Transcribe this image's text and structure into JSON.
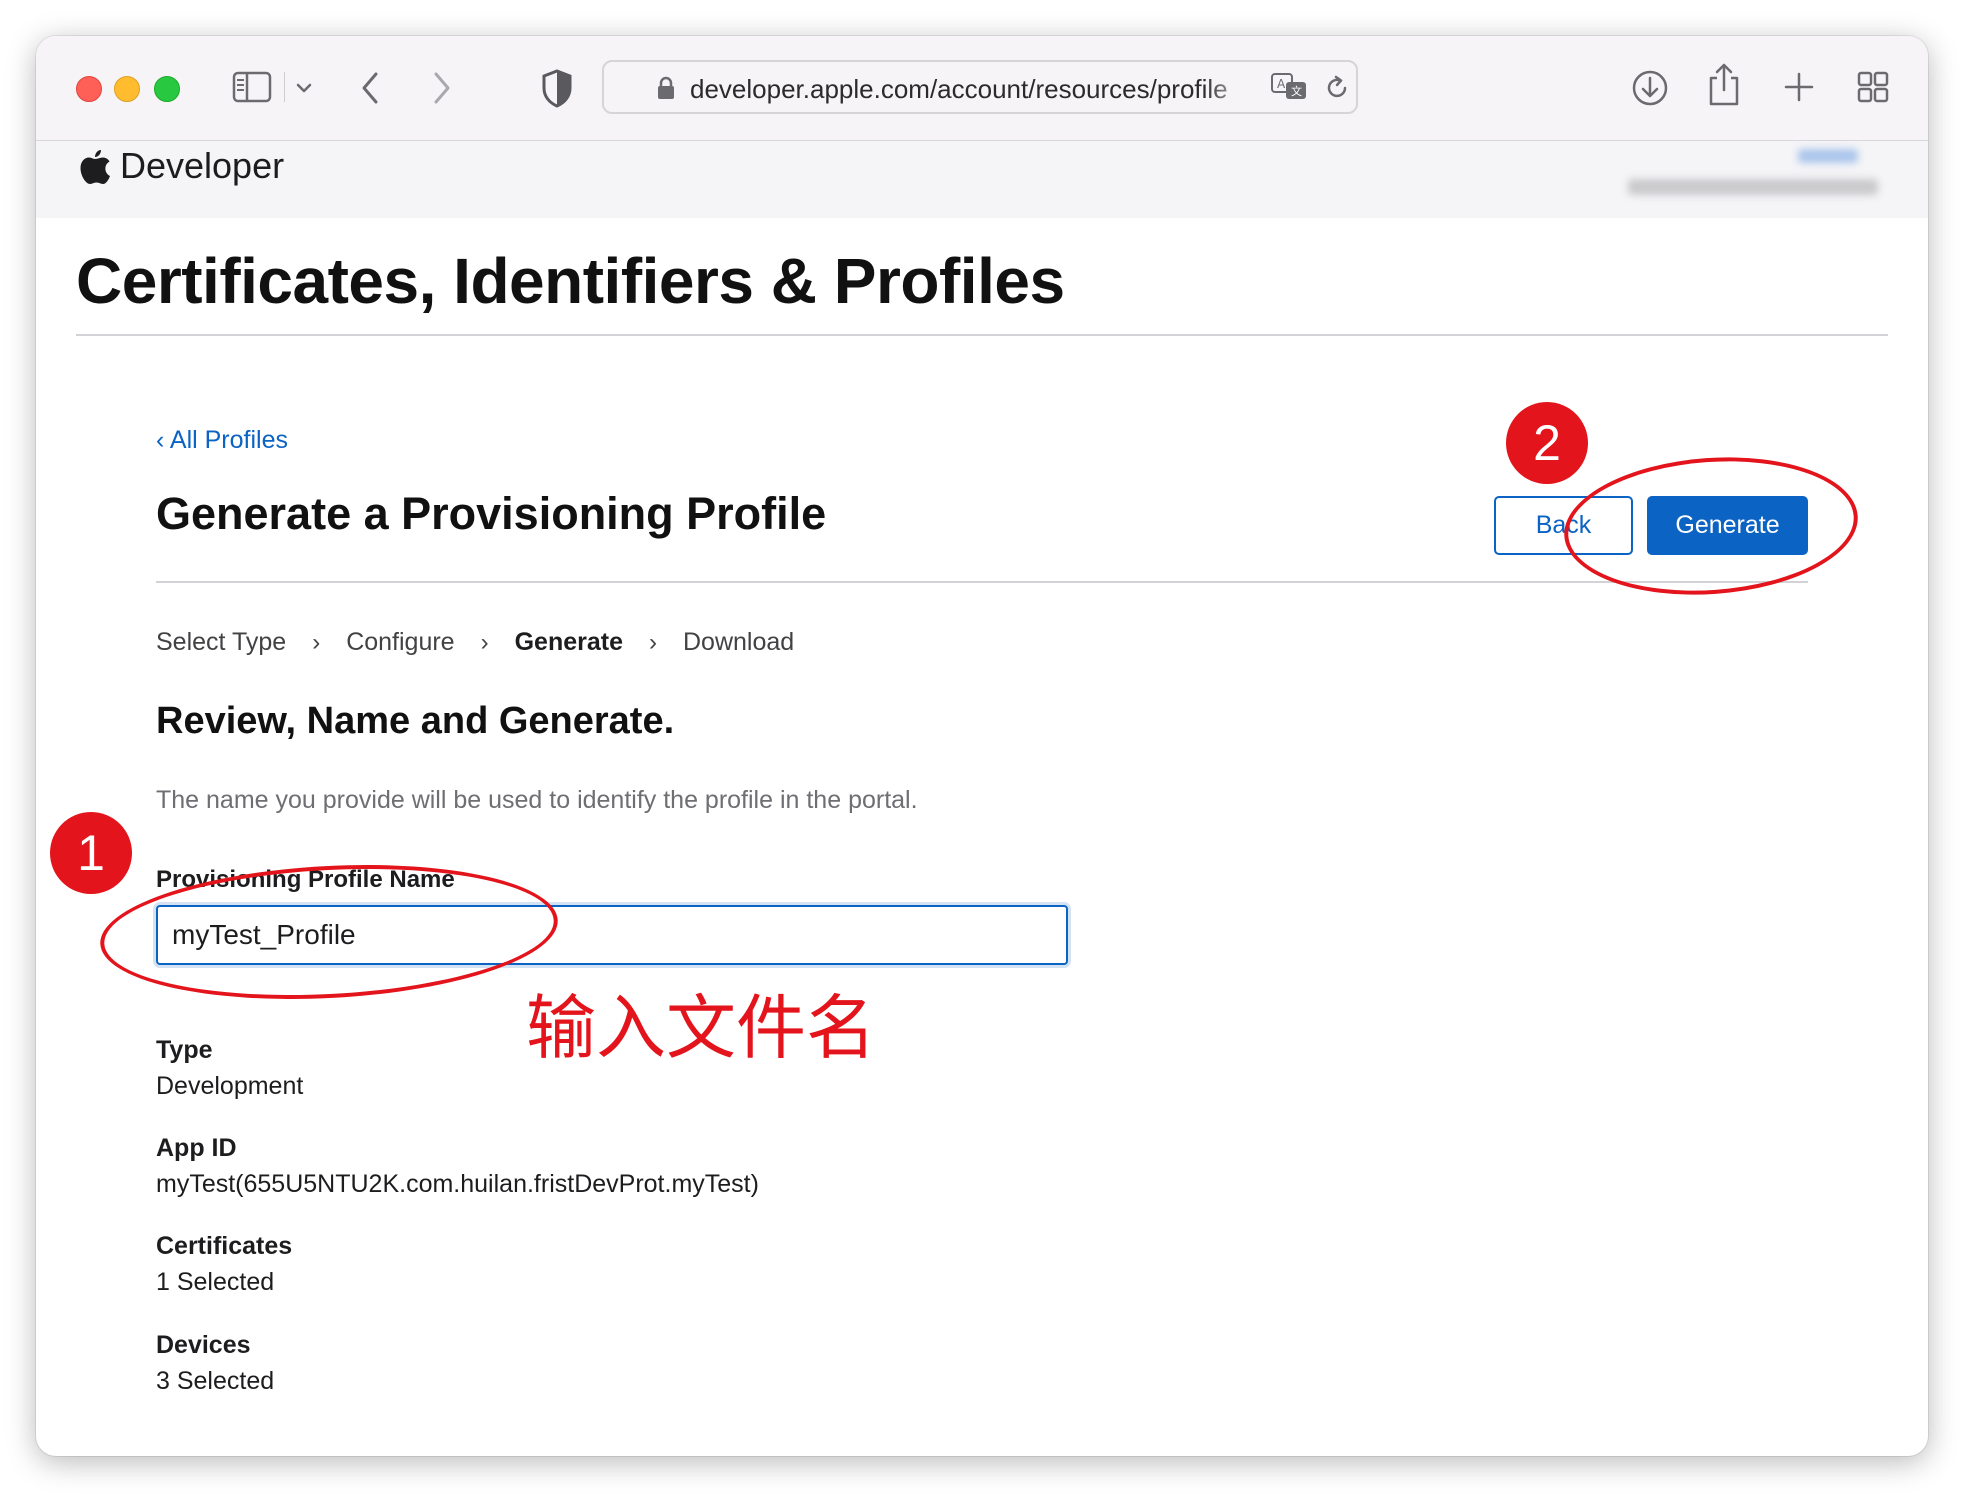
{
  "browser": {
    "url": "developer.apple.com/account/resources/profile"
  },
  "site": {
    "brand": "Developer"
  },
  "page": {
    "title": "Certificates, Identifiers & Profiles",
    "back_link": "All Profiles",
    "section_title": "Generate a Provisioning Profile",
    "buttons": {
      "back": "Back",
      "generate": "Generate"
    },
    "steps": [
      {
        "label": "Select Type",
        "active": false
      },
      {
        "label": "Configure",
        "active": false
      },
      {
        "label": "Generate",
        "active": true
      },
      {
        "label": "Download",
        "active": false
      }
    ],
    "review_title": "Review, Name and Generate.",
    "description": "The name you provide will be used to identify the profile in the portal.",
    "name_field": {
      "label": "Provisioning Profile Name",
      "value": "myTest_Profile"
    },
    "details": [
      {
        "label": "Type",
        "value": "Development"
      },
      {
        "label": "App ID",
        "value": "myTest(655U5NTU2K.com.huilan.fristDevProt.myTest)"
      },
      {
        "label": "Certificates",
        "value": "1 Selected"
      },
      {
        "label": "Devices",
        "value": "3 Selected"
      }
    ]
  },
  "annotations": {
    "badge_1": "1",
    "badge_2": "2",
    "note": "输入文件名",
    "color": "#e3141b"
  },
  "colors": {
    "accent": "#0b63c4",
    "toolbar": "#f6f4f7"
  },
  "icons": [
    "sidebar-icon",
    "chevron-down-icon",
    "back-arrow-icon",
    "forward-arrow-icon",
    "shield-icon",
    "lock-icon",
    "translate-icon",
    "reload-icon",
    "download-icon",
    "share-icon",
    "new-tab-icon",
    "tab-overview-icon",
    "apple-logo-icon"
  ]
}
